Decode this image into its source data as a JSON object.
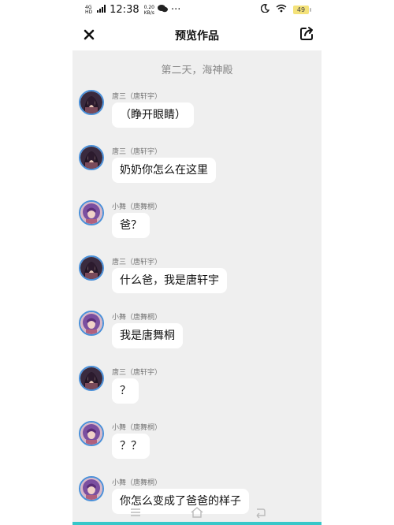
{
  "status_bar": {
    "network_top": "4G",
    "network_bottom": "HD",
    "time": "12:38",
    "speed_value": "0.20",
    "speed_unit": "KB/s",
    "more": "···",
    "battery": "49"
  },
  "header": {
    "title": "预览作品"
  },
  "chat": {
    "scene": "第二天，海神殿",
    "messages": [
      {
        "speaker": "唐三（唐轩宇）",
        "text": "（睁开眼睛）",
        "avatar": "tang-san"
      },
      {
        "speaker": "唐三（唐轩宇）",
        "text": "奶奶你怎么在这里",
        "avatar": "tang-san"
      },
      {
        "speaker": "小舞（唐舞桐）",
        "text": "爸？",
        "avatar": "xiao-wu"
      },
      {
        "speaker": "唐三（唐轩宇）",
        "text": "什么爸，我是唐轩宇",
        "avatar": "tang-san"
      },
      {
        "speaker": "小舞（唐舞桐）",
        "text": "我是唐舞桐",
        "avatar": "xiao-wu"
      },
      {
        "speaker": "唐三（唐轩宇）",
        "text": "？",
        "avatar": "tang-san"
      },
      {
        "speaker": "小舞（唐舞桐）",
        "text": "？？",
        "avatar": "xiao-wu"
      },
      {
        "speaker": "小舞（唐舞桐）",
        "text": "你怎么变成了爸爸的样子",
        "avatar": "xiao-wu"
      }
    ]
  },
  "colors": {
    "chat_background": "#efefef",
    "bubble": "#ffffff",
    "avatar_border": "#4a90d9",
    "accent_line": "#37c7c9"
  }
}
